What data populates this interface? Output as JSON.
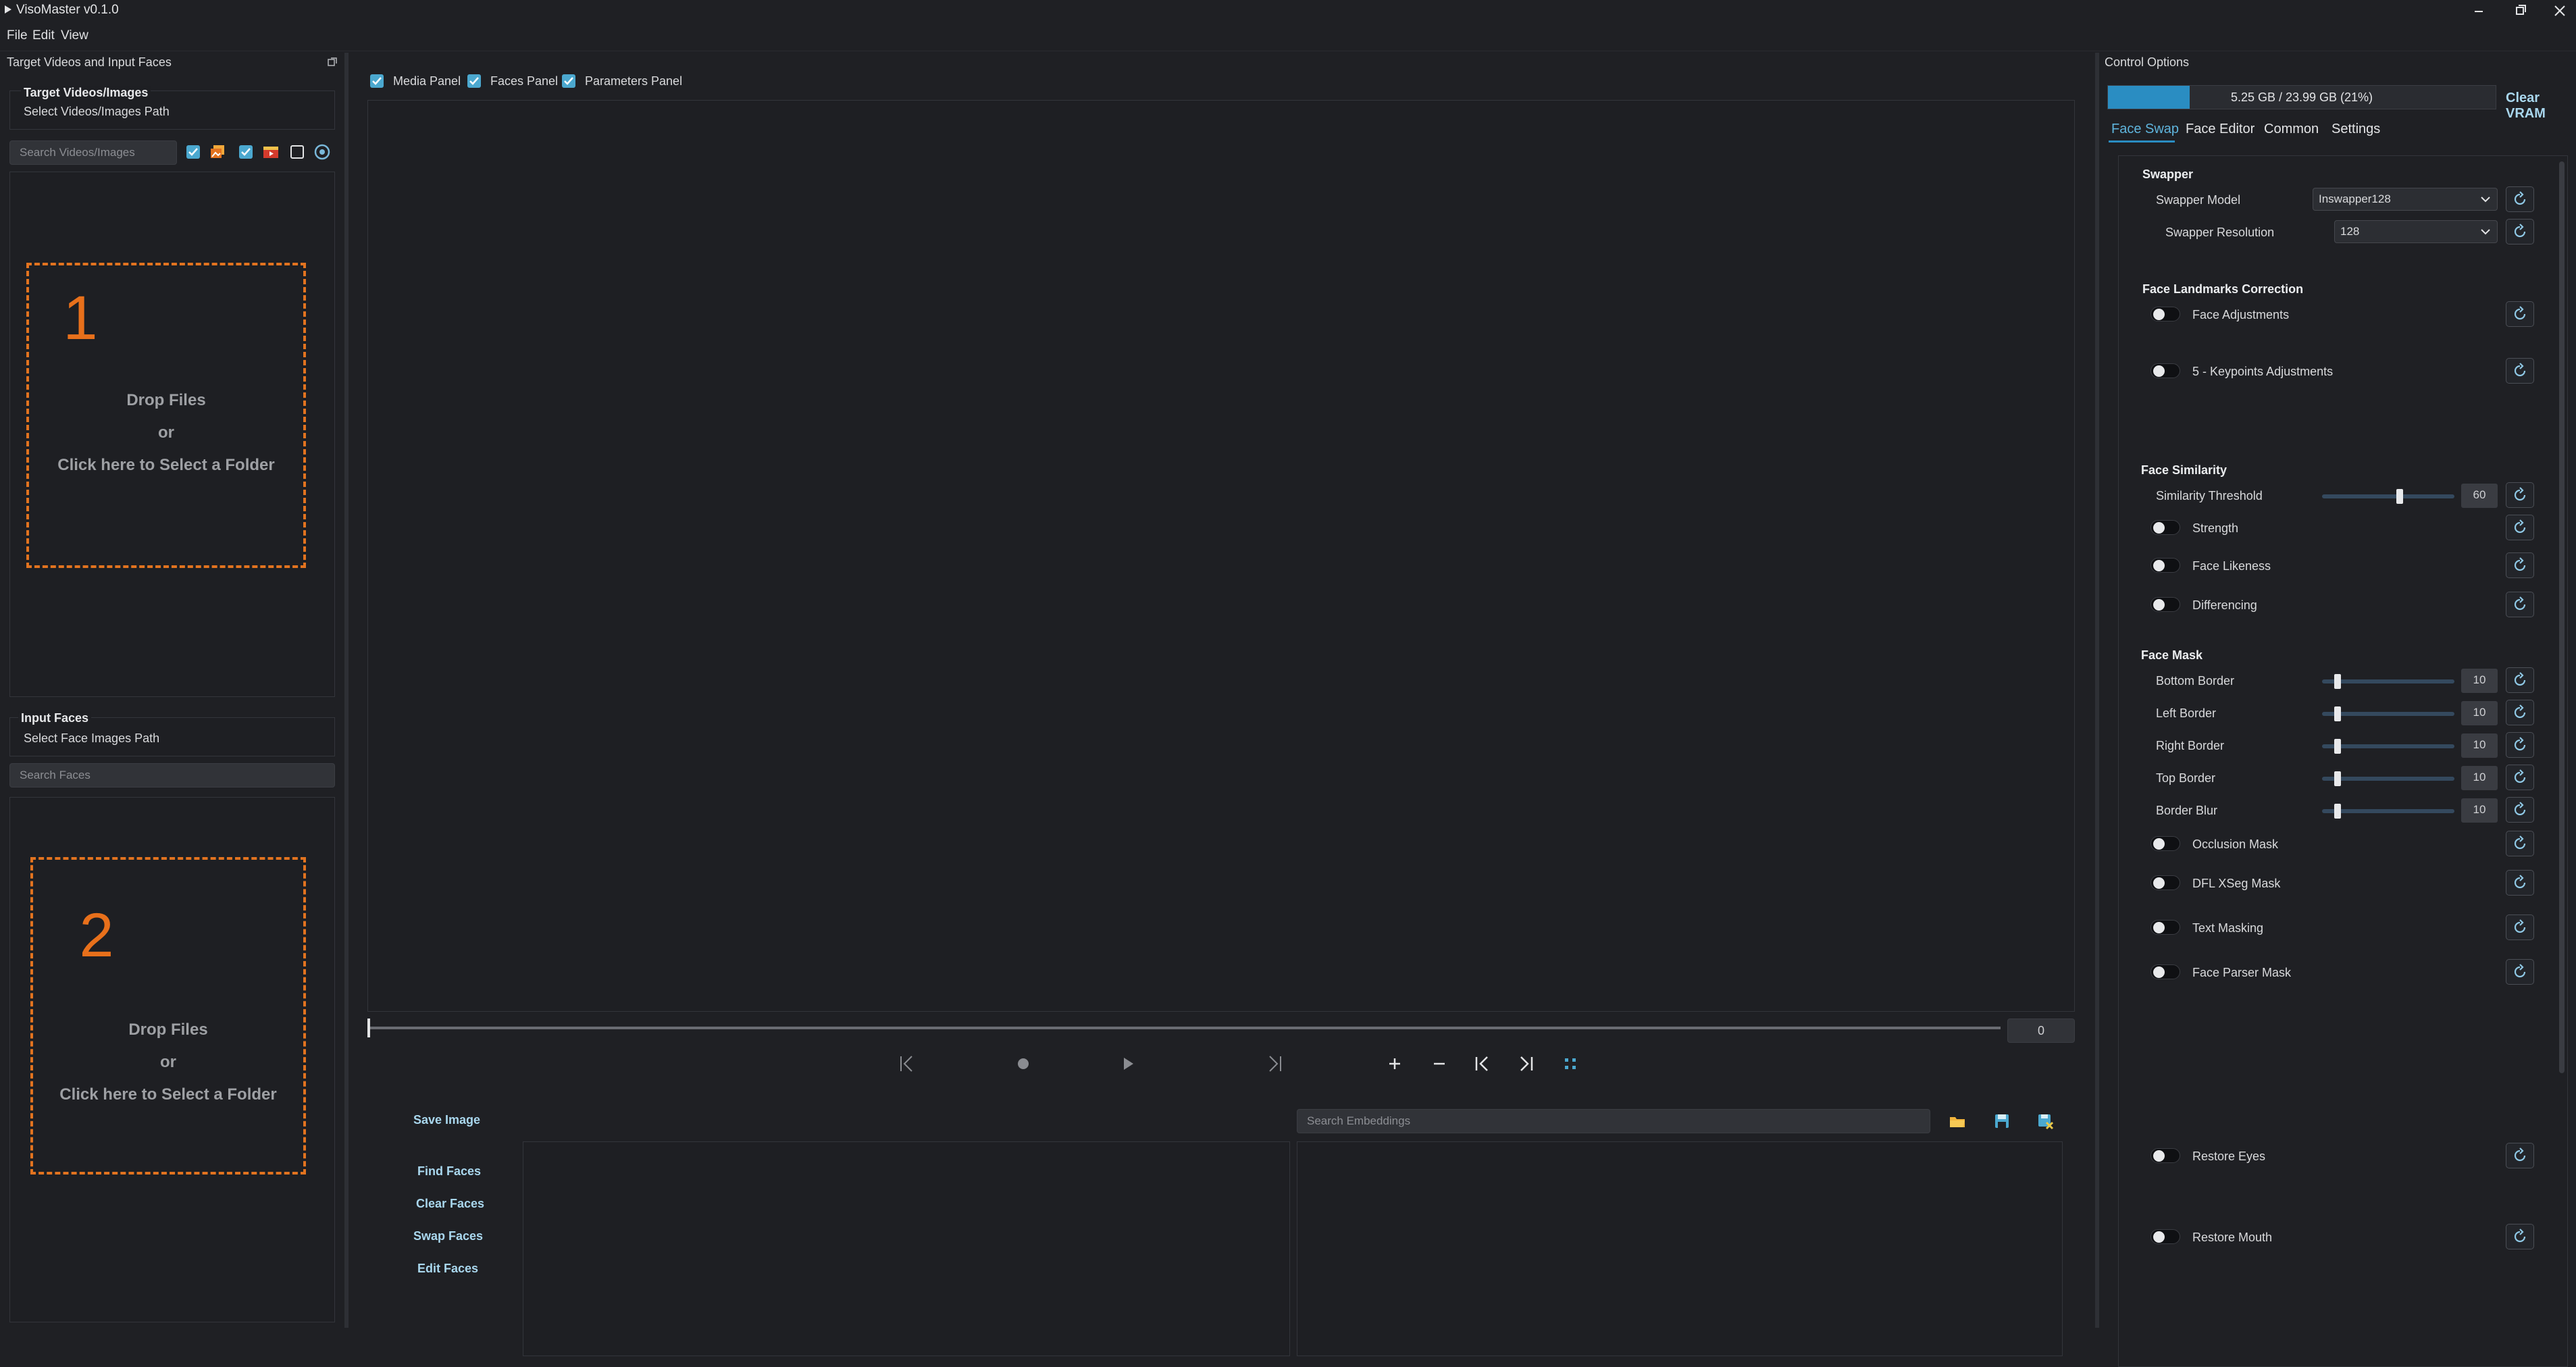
{
  "app": {
    "title": "VisoMaster v0.1.0"
  },
  "menu": [
    "File",
    "Edit",
    "View"
  ],
  "left_panel": {
    "dock_title": "Target Videos and Input Faces",
    "target_group_label": "Target Videos/Images",
    "target_path_label": "Select Videos/Images Path",
    "search_videos_placeholder": "Search Videos/Images",
    "drop_zone_1": {
      "number": "1",
      "line1": "Drop Files",
      "line2": "or",
      "line3": "Click here to Select a Folder"
    },
    "input_faces_label": "Input Faces",
    "face_path_label": "Select Face Images Path",
    "search_faces_placeholder": "Search Faces",
    "drop_zone_2": {
      "number": "2",
      "line1": "Drop Files",
      "line2": "or",
      "line3": "Click here to Select a Folder"
    }
  },
  "center": {
    "panels": [
      "Media Panel",
      "Faces Panel",
      "Parameters Panel"
    ],
    "frame_counter": "0",
    "save_image": "Save Image",
    "search_embeddings_placeholder": "Search Embeddings",
    "face_actions": [
      "Find Faces",
      "Clear Faces",
      "Swap Faces",
      "Edit Faces"
    ]
  },
  "right_panel": {
    "title": "Control Options",
    "vram_text": "5.25 GB / 23.99 GB (21%)",
    "vram_fraction": 0.21,
    "clear_vram": "Clear VRAM",
    "tabs": [
      "Face Swap",
      "Face Editor",
      "Common",
      "Settings"
    ],
    "swapper": {
      "title": "Swapper",
      "model_label": "Swapper Model",
      "model_value": "Inswapper128",
      "resolution_label": "Swapper Resolution",
      "resolution_value": "128"
    },
    "landmarks": {
      "title": "Face Landmarks Correction",
      "face_adjustments": "Face Adjustments",
      "keypoints_adjustments": "5 - Keypoints Adjustments"
    },
    "similarity": {
      "title": "Face Similarity",
      "threshold_label": "Similarity Threshold",
      "threshold_value": "60",
      "strength": "Strength",
      "face_likeness": "Face Likeness",
      "differencing": "Differencing"
    },
    "mask": {
      "title": "Face Mask",
      "bottom_border": "Bottom Border",
      "bottom_value": "10",
      "left_border": "Left Border",
      "left_value": "10",
      "right_border": "Right Border",
      "right_value": "10",
      "top_border": "Top Border",
      "top_value": "10",
      "border_blur": "Border Blur",
      "blur_value": "10",
      "occlusion_mask": "Occlusion Mask",
      "dfl_xseg_mask": "DFL XSeg Mask",
      "text_masking": "Text Masking",
      "face_parser_mask": "Face Parser Mask"
    },
    "restore_eyes": "Restore Eyes",
    "restore_mouth": "Restore Mouth"
  }
}
